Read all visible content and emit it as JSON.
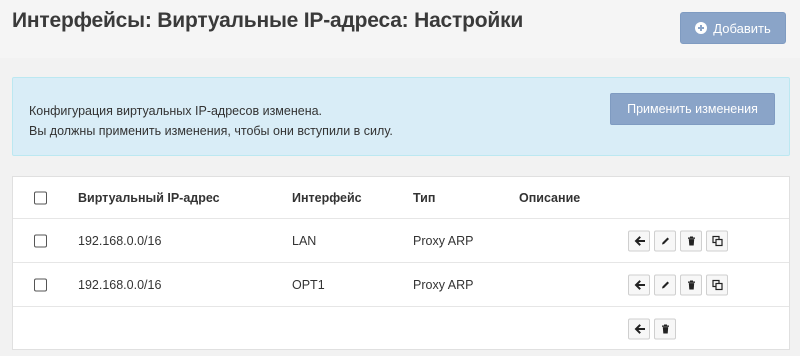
{
  "header": {
    "title": "Интерфейсы: Виртуальные IP-адреса: Настройки",
    "add_label": "Добавить"
  },
  "alert": {
    "line1": "Конфигурация виртуальных IP-адресов изменена.",
    "line2": "Вы должны применить изменения, чтобы они вступили в силу.",
    "apply_label": "Применить изменения"
  },
  "table": {
    "columns": [
      "Виртуальный IP-адрес",
      "Интерфейс",
      "Тип",
      "Описание"
    ],
    "rows": [
      {
        "ip": "192.168.0.0/16",
        "interface": "LAN",
        "type": "Proxy ARP",
        "description": ""
      },
      {
        "ip": "192.168.0.0/16",
        "interface": "OPT1",
        "type": "Proxy ARP",
        "description": ""
      }
    ]
  },
  "icons": {
    "add": "plus-circle-icon",
    "move": "arrow-left-icon",
    "edit": "pencil-icon",
    "delete": "trash-icon",
    "copy": "copy-icon"
  },
  "colors": {
    "primary_button": "#8aa4c8",
    "alert_bg": "#d9edf7",
    "alert_border": "#bce8f1"
  }
}
